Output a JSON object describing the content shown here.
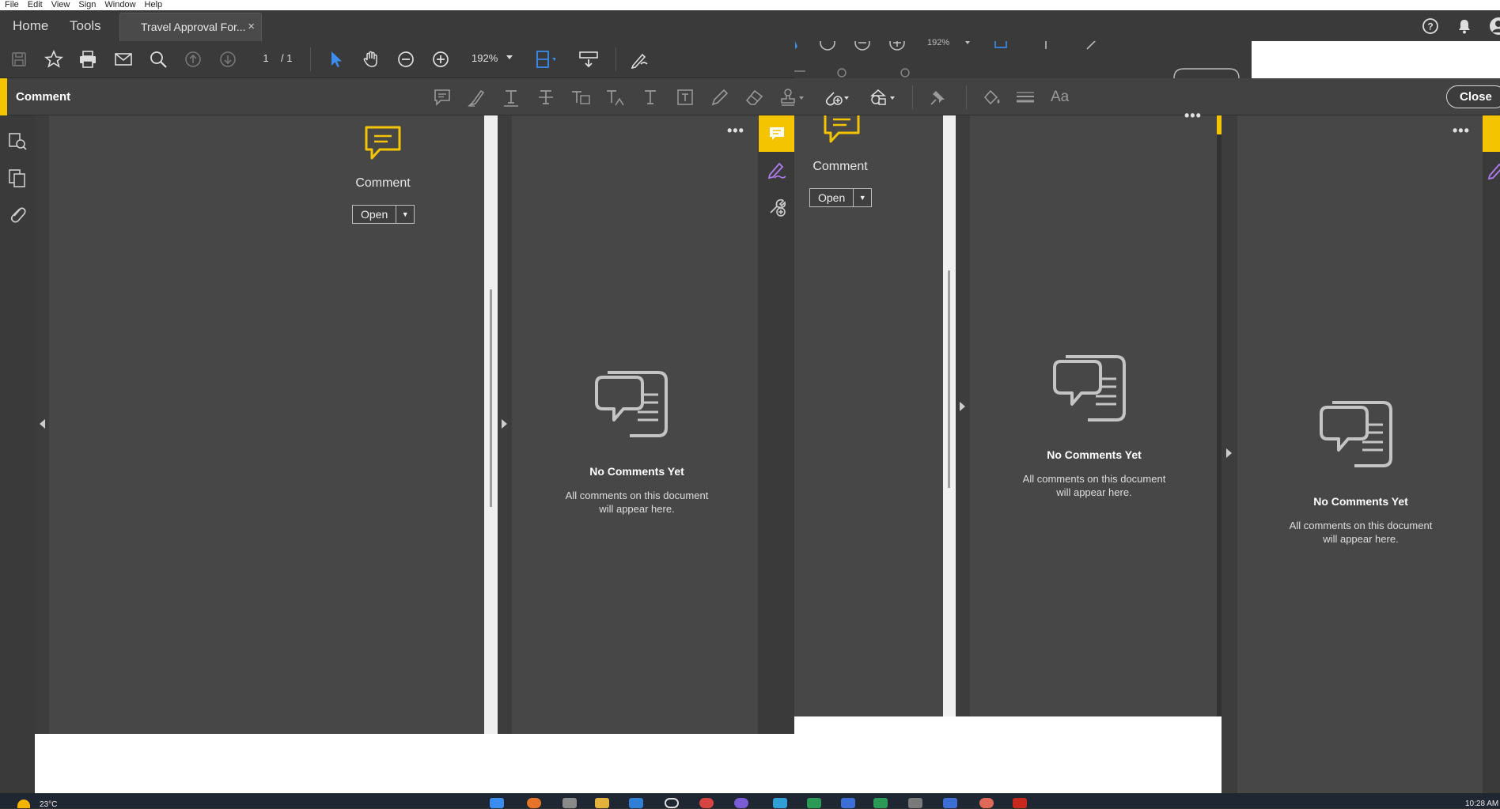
{
  "menu": [
    "File",
    "Edit",
    "View",
    "Sign",
    "Window",
    "Help"
  ],
  "tabs": {
    "home": "Home",
    "tools": "Tools",
    "document": "Travel Approval For...",
    "close_glyph": "×"
  },
  "page_nav": {
    "current": "1",
    "total": "/ 1"
  },
  "zoom": {
    "value": "192%",
    "ghost_value": "192%"
  },
  "comment_toolbar": {
    "label": "Comment",
    "close": "Close",
    "text_size": "Aa"
  },
  "panes": [
    {
      "tool_label": "Comment",
      "open_label": "Open"
    },
    {
      "tool_label": "Comment",
      "open_label": "Open"
    }
  ],
  "comment_lists": [
    {
      "title": "No Comments Yet",
      "desc_line1": "All comments on this document",
      "desc_line2": "will appear here."
    },
    {
      "title": "No Comments Yet",
      "desc_line1": "All comments on this document",
      "desc_line2": "will appear here."
    },
    {
      "title": "No Comments Yet",
      "desc_line1": "All comments on this document",
      "desc_line2": "will appear here."
    }
  ],
  "more_glyph": "•••",
  "taskbar": {
    "temperature": "23°C",
    "time": "10:28 AM"
  },
  "colors": {
    "accent_yellow": "#f5c400",
    "panel_bg": "#474747",
    "toolbar_bg": "#3a3a3a",
    "sign_purple": "#b07cf0",
    "select_blue": "#3b8df0"
  }
}
